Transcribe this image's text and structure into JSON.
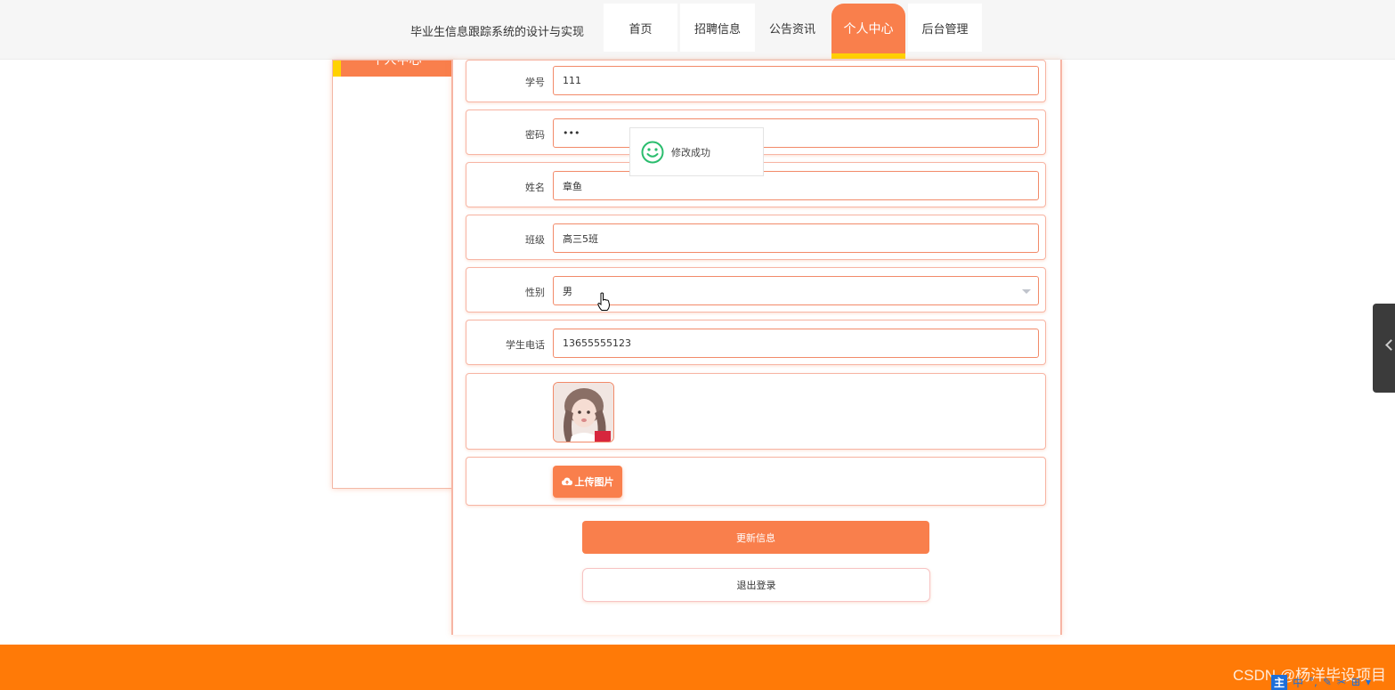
{
  "header": {
    "site_title": "毕业生信息跟踪系统的设计与实现",
    "nav": [
      {
        "label": "首页"
      },
      {
        "label": "招聘信息"
      },
      {
        "label": "公告资讯"
      },
      {
        "label": "个人中心",
        "active": true
      },
      {
        "label": "后台管理"
      }
    ]
  },
  "sidebar": {
    "title": "个人中心"
  },
  "form": {
    "student_id": {
      "label": "学号",
      "value": "111"
    },
    "password": {
      "label": "密码",
      "value": "•••"
    },
    "name": {
      "label": "姓名",
      "value": "章鱼"
    },
    "class": {
      "label": "班级",
      "value": "高三5班"
    },
    "gender": {
      "label": "性别",
      "value": "男"
    },
    "phone": {
      "label": "学生电话",
      "value": "13655555123"
    },
    "upload_label": "上传图片",
    "update_label": "更新信息",
    "logout_label": "退出登录"
  },
  "toast": {
    "message": "修改成功",
    "icon": "smile-icon"
  },
  "footer": {
    "watermark": "CSDN @杨洋毕设项目"
  },
  "ime": [
    "主",
    "中",
    "°,",
    "✎",
    "✂",
    "⊞",
    "▾"
  ],
  "colors": {
    "accent": "#f97f4c",
    "highlight": "#ffd200",
    "footer": "#ff7a07",
    "success": "#2bbd6e"
  }
}
